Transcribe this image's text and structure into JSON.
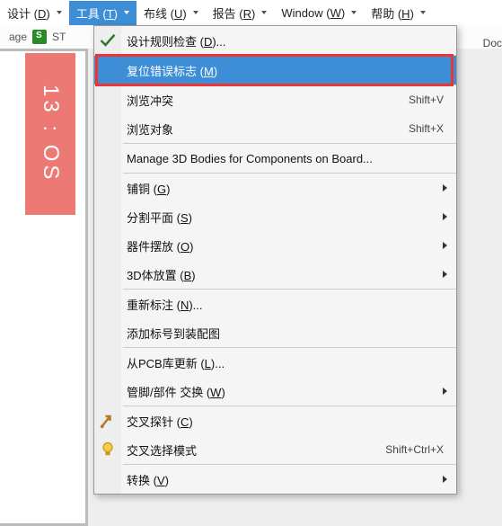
{
  "menubar": {
    "items": [
      {
        "label": "设计",
        "key": "D"
      },
      {
        "label": "工具",
        "key": "T",
        "active": true
      },
      {
        "label": "布线",
        "key": "U"
      },
      {
        "label": "报告",
        "key": "R"
      },
      {
        "label": "Window",
        "key": "W"
      },
      {
        "label": "帮助",
        "key": "H"
      }
    ]
  },
  "toolbar": {
    "left": "age",
    "st": "ST",
    "right_snip": "Doc"
  },
  "red_block_text": "13 : OS",
  "dropdown": {
    "groups": [
      {
        "items": [
          {
            "label": "设计规则检查 (",
            "key": "D",
            "suffix": ")...",
            "icon": "check"
          }
        ]
      },
      {
        "items": [
          {
            "label": "复位错误标志 (",
            "key": "M",
            "suffix": ")",
            "selected": true
          }
        ]
      },
      {
        "items": [
          {
            "label": "浏览冲突",
            "shortcut": "Shift+V"
          },
          {
            "label": "浏览对象",
            "shortcut": "Shift+X"
          }
        ]
      },
      {
        "items": [
          {
            "label": "Manage 3D Bodies for Components on Board..."
          }
        ]
      },
      {
        "items": [
          {
            "label": "铺铜 (",
            "key": "G",
            "suffix": ")",
            "submenu": true
          },
          {
            "label": "分割平面 (",
            "key": "S",
            "suffix": ")",
            "submenu": true
          },
          {
            "label": "器件摆放 (",
            "key": "O",
            "suffix": ")",
            "submenu": true
          },
          {
            "label": "3D体放置 (",
            "key": "B",
            "suffix": ")",
            "submenu": true
          }
        ]
      },
      {
        "items": [
          {
            "label": "重新标注 (",
            "key": "N",
            "suffix": ")..."
          },
          {
            "label": "添加标号到装配图"
          }
        ]
      },
      {
        "items": [
          {
            "label": "从PCB库更新 (",
            "key": "L",
            "suffix": ")..."
          },
          {
            "label": "管脚/部件 交换 (",
            "key": "W",
            "suffix": ")",
            "submenu": true
          }
        ]
      },
      {
        "items": [
          {
            "label": "交叉探针 (",
            "key": "C",
            "suffix": ")",
            "icon": "cross"
          },
          {
            "label": "交叉选择模式",
            "shortcut": "Shift+Ctrl+X",
            "icon": "bulb"
          }
        ]
      },
      {
        "items": [
          {
            "label": "转换 (",
            "key": "V",
            "suffix": ")",
            "submenu": true
          }
        ]
      }
    ]
  }
}
